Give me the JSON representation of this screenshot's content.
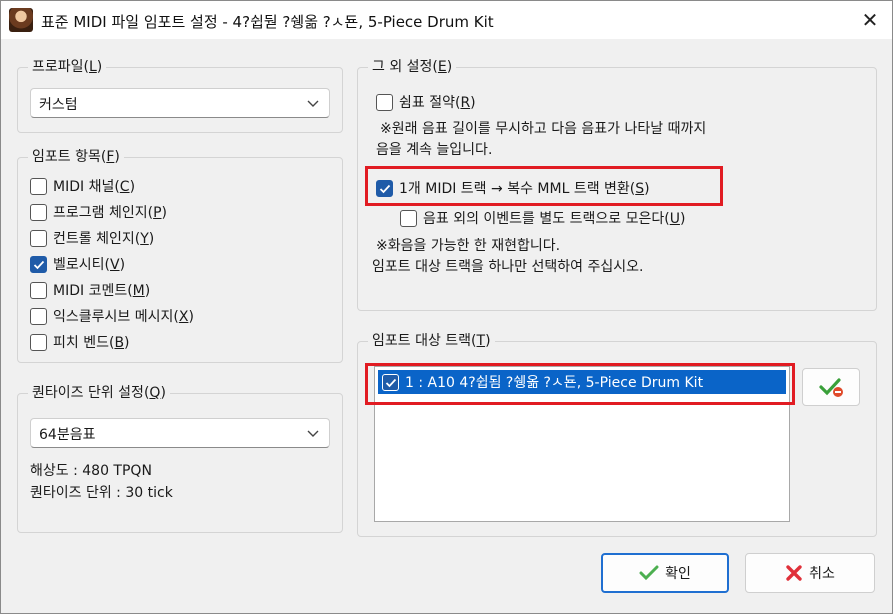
{
  "window": {
    "title": "표준 MIDI 파일 임포트 설정 - 4?쉽둳 ?쉥옮 ?ㅅ됸, 5-Piece Drum Kit",
    "close_glyph": "✕"
  },
  "profile": {
    "legend": "프로파일(L)",
    "legend_text": "프로파일(",
    "legend_key": "L",
    "value": "커스텀"
  },
  "import_items": {
    "legend_text": "임포트 항목(",
    "legend_key": "F",
    "items": [
      {
        "text": "MIDI 채널(",
        "key": "C",
        "checked": false
      },
      {
        "text": "프로그램 체인지(",
        "key": "P",
        "checked": false
      },
      {
        "text": "컨트롤 체인지(",
        "key": "Y",
        "checked": false
      },
      {
        "text": "벨로시티(",
        "key": "V",
        "checked": true
      },
      {
        "text": "MIDI 코멘트(",
        "key": "M",
        "checked": false
      },
      {
        "text": "익스클루시브 메시지(",
        "key": "X",
        "checked": false
      },
      {
        "text": "피치 벤드(",
        "key": "B",
        "checked": false
      }
    ]
  },
  "quantize": {
    "legend_text": "퀀타이즈 단위 설정(",
    "legend_key": "Q",
    "value": "64분음표",
    "resolution": "해상도 : 480 TPQN",
    "unit": "퀀타이즈 단위 : 30 tick"
  },
  "other": {
    "legend_text": "그 외 설정(",
    "legend_key": "E",
    "rest_saving_text": "쉼표 절약(",
    "rest_saving_key": "R",
    "rest_saving_checked": false,
    "note1_line1": "※원래 음표 길이를 무시하고 다음 음표가 나타날 때까지",
    "note1_line2": "음을 계속 늘입니다.",
    "convert_text": "1개 MIDI 트랙 → 복수 MML 트랙 변환(",
    "convert_key": "S",
    "convert_checked": true,
    "collect_text": "음표 외의 이벤트를 별도 트랙으로 모은다(",
    "collect_key": "U",
    "collect_checked": false,
    "note2_line1": "※화음을 가능한 한 재현합니다.",
    "note2_line2": "임포트 대상 트랙을 하나만 선택하여 주십시오."
  },
  "tracks": {
    "legend_text": "임포트 대상 트랙(",
    "legend_key": "T",
    "items": [
      {
        "label": "1 : A10 4?쉽됨 ?쉥옮 ?ㅅ됸, 5-Piece Drum Kit",
        "checked": true,
        "selected": true
      }
    ]
  },
  "buttons": {
    "ok_label": "확인",
    "cancel_label": "취소"
  },
  "colors": {
    "highlight": "#e11b22",
    "selection": "#0a64c8",
    "check": "#1f5ba8"
  }
}
